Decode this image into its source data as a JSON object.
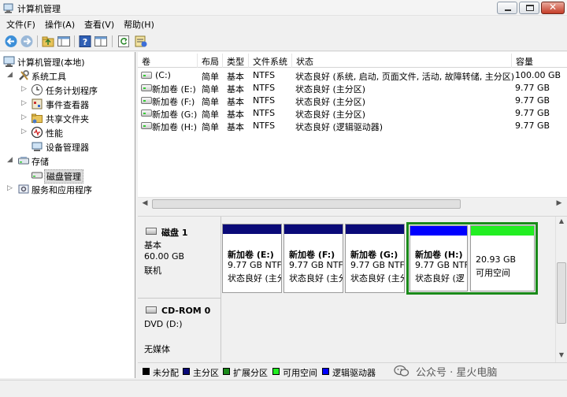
{
  "window": {
    "title": "计算机管理",
    "close_glyph": "✕"
  },
  "menu": [
    "文件(F)",
    "操作(A)",
    "查看(V)",
    "帮助(H)"
  ],
  "toolbar": [
    "back-arrow-icon",
    "forward-arrow-icon",
    "up-folder-icon",
    "show-hide-tree-icon",
    "help-icon",
    "console-view-icon",
    "refresh-icon",
    "properties-icon"
  ],
  "tree": {
    "root": "计算机管理(本地)",
    "system_tools": "系统工具",
    "task_scheduler": "任务计划程序",
    "event_viewer": "事件查看器",
    "shared_folders": "共享文件夹",
    "performance": "性能",
    "device_manager": "设备管理器",
    "storage": "存储",
    "disk_management": "磁盘管理",
    "services_apps": "服务和应用程序"
  },
  "volumes": {
    "headers": [
      "卷",
      "布局",
      "类型",
      "文件系统",
      "状态",
      "容量"
    ],
    "rows": [
      [
        "(C:)",
        "简单",
        "基本",
        "NTFS",
        "状态良好 (系统, 启动, 页面文件, 活动, 故障转储, 主分区)",
        "100.00 GB"
      ],
      [
        "新加卷 (E:)",
        "简单",
        "基本",
        "NTFS",
        "状态良好 (主分区)",
        "9.77 GB"
      ],
      [
        "新加卷 (F:)",
        "简单",
        "基本",
        "NTFS",
        "状态良好 (主分区)",
        "9.77 GB"
      ],
      [
        "新加卷 (G:)",
        "简单",
        "基本",
        "NTFS",
        "状态良好 (主分区)",
        "9.77 GB"
      ],
      [
        "新加卷 (H:)",
        "简单",
        "基本",
        "NTFS",
        "状态良好 (逻辑驱动器)",
        "9.77 GB"
      ]
    ]
  },
  "disk1": {
    "name": "磁盘 1",
    "type": "基本",
    "size": "60.00 GB",
    "status": "联机",
    "partitions": [
      {
        "name": "新加卷 (E:)",
        "size": "9.77 GB NTF",
        "status": "状态良好 (主分",
        "bar_color": "#0a0a78"
      },
      {
        "name": "新加卷 (F:)",
        "size": "9.77 GB NTF",
        "status": "状态良好 (主分",
        "bar_color": "#0a0a78"
      },
      {
        "name": "新加卷 (G:)",
        "size": "9.77 GB NTF",
        "status": "状态良好 (主分",
        "bar_color": "#0a0a78"
      },
      {
        "name": "新加卷 (H:)",
        "size": "9.77 GB NTF",
        "status": "状态良好 (逻",
        "bar_color": "#0000ff"
      },
      {
        "name": "",
        "size": "20.93 GB",
        "status": "可用空间",
        "bar_color": "#22ee22"
      }
    ],
    "extended_border_color": "#1a8a1a"
  },
  "cdrom": {
    "name": "CD-ROM 0",
    "type": "DVD (D:)",
    "media": "无媒体"
  },
  "legend": [
    {
      "label": "未分配",
      "color": "#000000"
    },
    {
      "label": "主分区",
      "color": "#0a0a78"
    },
    {
      "label": "扩展分区",
      "color": "#1a8a1a"
    },
    {
      "label": "可用空间",
      "color": "#22ee22"
    },
    {
      "label": "逻辑驱动器",
      "color": "#0000ff"
    }
  ],
  "watermark": "公众号 · 星火电脑"
}
